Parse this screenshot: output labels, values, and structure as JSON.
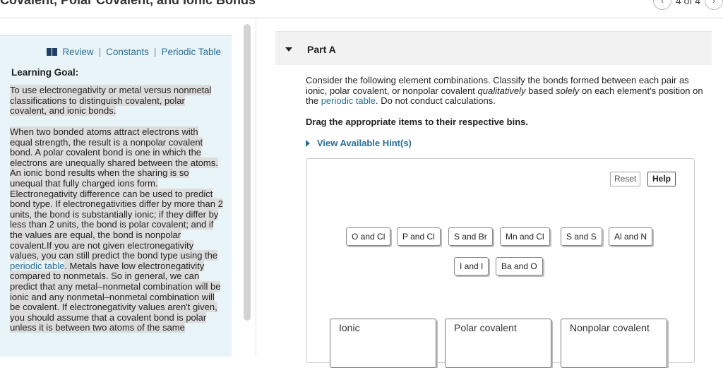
{
  "header": {
    "title": "Covalent, Polar Covalent, and Ionic Bonds",
    "pager": "4 of 4",
    "prev_icon": "chevron-left-icon",
    "next_icon": "chevron-right-icon"
  },
  "sidebar": {
    "links": {
      "review": "Review",
      "constants": "Constants",
      "periodic_table": "Periodic Table",
      "separator": "|"
    },
    "goal_title": "Learning Goal:",
    "goal_text": "To use electronegativity or metal versus nonmetal classifications to distinguish covalent, polar covalent, and ionic bonds.",
    "body_before_link": "When two bonded atoms attract electrons with equal strength, the result is a nonpolar covalent bond. A polar covalent bond is one in which the electrons are unequally shared between the atoms. An ionic bond results when the sharing is so unequal that fully charged ions form. Electronegativity difference can be used to predict bond type. If electronegativities differ by more than 2 units, the bond is substantially ionic; if they differ by less than 2 units, the bond is polar covalent; and if the values are equal, the bond is nonpolar covalent.If you are not given electronegativity values, you can still predict the bond type using the ",
    "body_link": "periodic table",
    "body_after_link": ". Metals have low electronegativity compared to nonmetals. So in general, we can predict that any metal–nonmetal combination will be ionic and any nonmetal–nonmetal combination will be covalent. If electronegativity values aren't given, you should assume that a covalent bond is polar unless it is between two atoms of the same"
  },
  "part": {
    "title": "Part A",
    "question_1": "Consider the following element combinations. Classify the bonds formed between each pair as ionic, polar covalent, or nonpolar covalent ",
    "question_em1": "qualitatively",
    "question_2": " based ",
    "question_em2": "solely",
    "question_3": " on each element's position on the ",
    "question_link": "periodic table",
    "question_4": ". Do not conduct calculations.",
    "instruction": "Drag the appropriate items to their respective bins.",
    "hint": "View Available Hint(s)"
  },
  "drag": {
    "reset": "Reset",
    "help": "Help",
    "items": [
      "O and Cl",
      "P and Cl",
      "S and Br",
      "Mn and Cl",
      "S and S",
      "Al and N",
      "I and I",
      "Ba and O"
    ],
    "bins": [
      "Ionic",
      "Polar covalent",
      "Nonpolar covalent"
    ]
  }
}
